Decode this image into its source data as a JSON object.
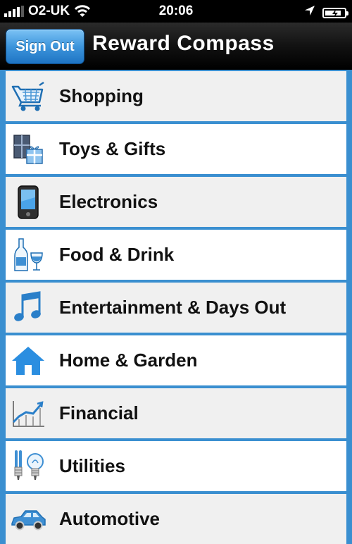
{
  "status_bar": {
    "carrier": "O2-UK",
    "time": "20:06",
    "battery_level": 0.85
  },
  "nav_bar": {
    "sign_out_label": "Sign Out",
    "title": "Reward Compass"
  },
  "categories": [
    {
      "label": "Shopping",
      "icon": "shopping-cart-icon"
    },
    {
      "label": "Toys & Gifts",
      "icon": "gift-icon"
    },
    {
      "label": "Electronics",
      "icon": "device-icon"
    },
    {
      "label": "Food & Drink",
      "icon": "wine-icon"
    },
    {
      "label": "Entertainment & Days Out",
      "icon": "music-note-icon"
    },
    {
      "label": "Home & Garden",
      "icon": "house-icon"
    },
    {
      "label": "Financial",
      "icon": "graph-icon"
    },
    {
      "label": "Utilities",
      "icon": "light-bulb-icon"
    },
    {
      "label": "Automotive",
      "icon": "car-icon"
    }
  ],
  "colors": {
    "separator": "#3a8fd0",
    "row_grey": "#f0f0f0",
    "row_white": "#ffffff",
    "button_blue": "#3d95dc"
  }
}
